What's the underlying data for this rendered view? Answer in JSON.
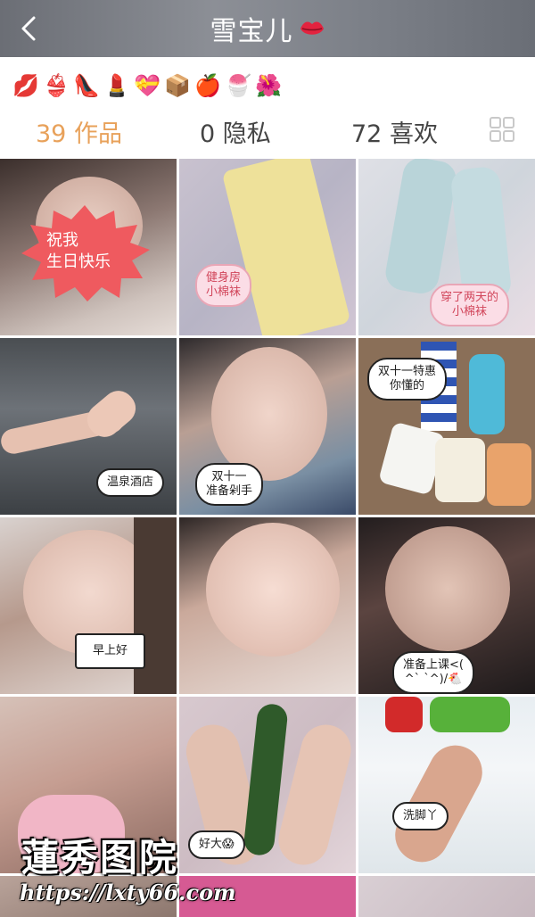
{
  "header": {
    "title": "雪宝儿",
    "title_icon": "lips-icon",
    "back_icon": "chevron-left-icon"
  },
  "emoji_bar": [
    "💋",
    "👙",
    "👠",
    "💄",
    "💝",
    "📦",
    "🍎",
    "🍧",
    "🌺"
  ],
  "tabs": [
    {
      "label": "39 作品",
      "active": true
    },
    {
      "label": "0 隐私",
      "active": false
    },
    {
      "label": "72 喜欢",
      "active": false
    }
  ],
  "view_toggle_icon": "grid-view-icon",
  "posts": [
    {
      "caption": "祝我\n生日快乐"
    },
    {
      "caption": "健身房\n小棉袜"
    },
    {
      "caption": "穿了两天的\n小棉袜"
    },
    {
      "caption": "温泉酒店"
    },
    {
      "caption": "双十一\n准备剁手"
    },
    {
      "caption": "双十一特惠\n你懂的"
    },
    {
      "caption": "早上好"
    },
    {
      "caption": ""
    },
    {
      "caption": "准备上课<(\n^` `^)/🐔"
    },
    {
      "caption": ""
    },
    {
      "caption": "好大😱"
    },
    {
      "caption": "洗脚丫"
    }
  ],
  "watermark": {
    "name": "蓮秀图院",
    "url": "https://lxty66.com"
  },
  "colors": {
    "accent": "#e8a15a",
    "header_bg": "#7b7f87"
  }
}
